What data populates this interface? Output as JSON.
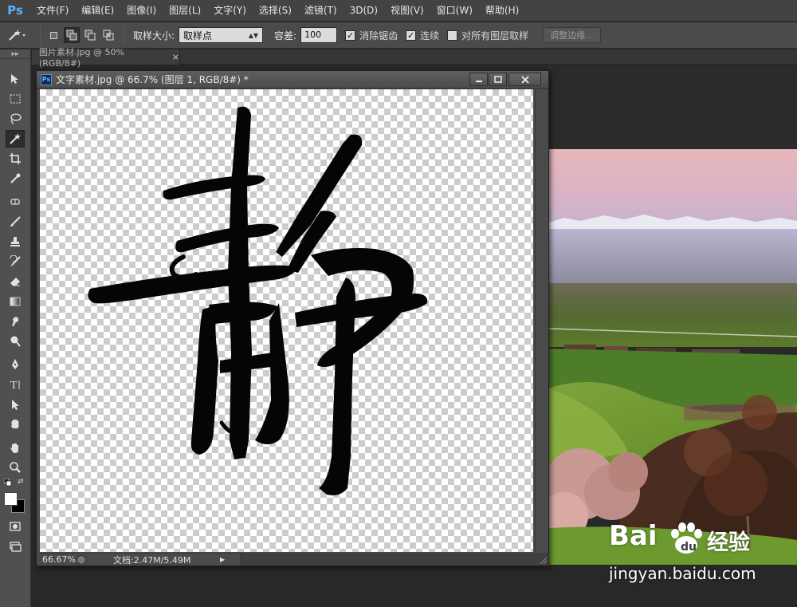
{
  "app": {
    "logo": "Ps"
  },
  "menu": [
    "文件(F)",
    "编辑(E)",
    "图像(I)",
    "图层(L)",
    "文字(Y)",
    "选择(S)",
    "滤镜(T)",
    "3D(D)",
    "视图(V)",
    "窗口(W)",
    "帮助(H)"
  ],
  "options": {
    "sample_size_label": "取样大小:",
    "sample_size_value": "取样点",
    "tolerance_label": "容差:",
    "tolerance_value": "100",
    "anti_alias_label": "消除锯齿",
    "anti_alias_checked": true,
    "contiguous_label": "连续",
    "contiguous_checked": true,
    "sample_all_label": "对所有图层取样",
    "sample_all_checked": false,
    "refine_edge_label": "调整边缘..."
  },
  "tabs": [
    {
      "label": "图片素材.jpg @ 50%(RGB/8#)",
      "close": "×"
    }
  ],
  "floating_window": {
    "title": "文字素材.jpg @ 66.7% (图层 1, RGB/8#) *",
    "zoom": "66.67%",
    "doc_size": "文档:2.47M/5.49M",
    "artwork_character": "静"
  },
  "watermark": {
    "brand_latin": "Bai",
    "brand_cn": "经验",
    "url": "jingyan.baidu.com"
  },
  "colors": {
    "ps_blue": "#5ab2ff",
    "panel": "#505050",
    "accent_bg": "#282828"
  }
}
